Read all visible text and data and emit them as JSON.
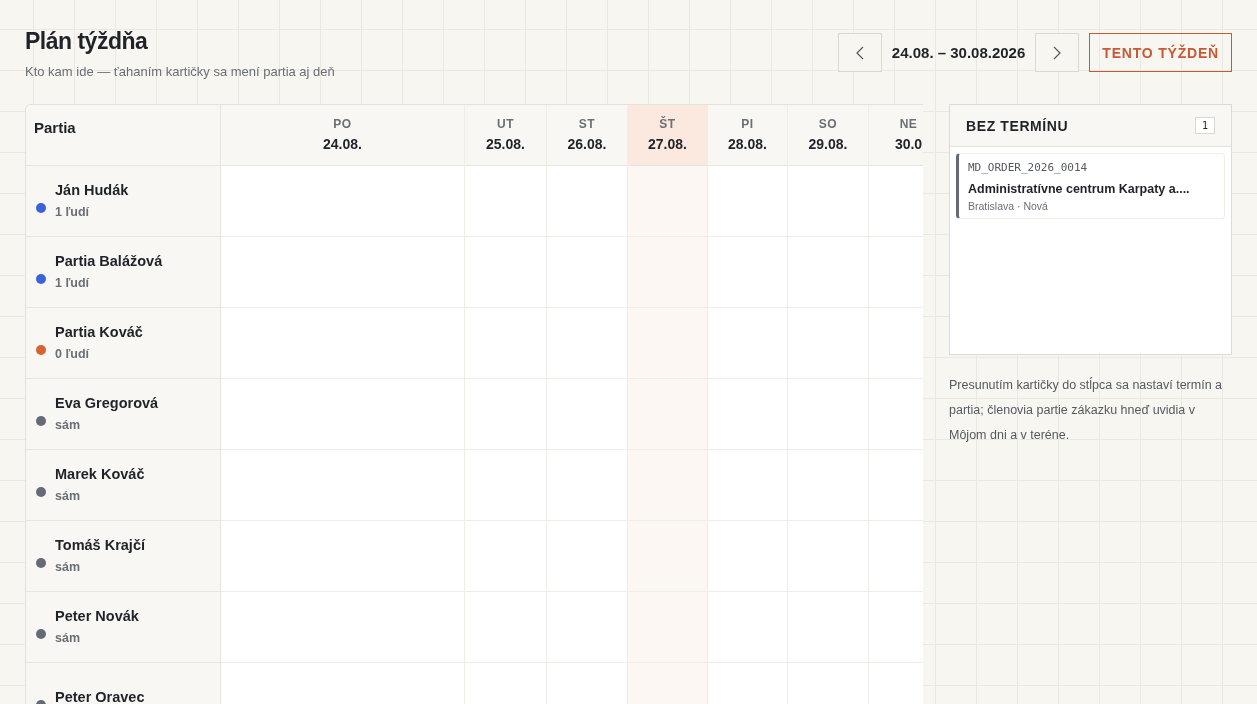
{
  "header": {
    "title": "Plán týždňa",
    "subtitle": "Kto kam ide — ťahaním kartičky sa mení partia aj deň"
  },
  "week_nav": {
    "range": "24.08. – 30.08.2026",
    "today_button": "TENTO TÝŽDEŇ"
  },
  "board": {
    "corner_label": "Partia",
    "days": [
      {
        "name": "PO",
        "date": "24.08.",
        "selected": false
      },
      {
        "name": "UT",
        "date": "25.08.",
        "selected": false
      },
      {
        "name": "ST",
        "date": "26.08.",
        "selected": false
      },
      {
        "name": "ŠT",
        "date": "27.08.",
        "selected": true
      },
      {
        "name": "PI",
        "date": "28.08.",
        "selected": false
      },
      {
        "name": "SO",
        "date": "29.08.",
        "selected": false
      },
      {
        "name": "NE",
        "date": "30.0",
        "selected": false
      }
    ],
    "crews": [
      {
        "name": "Ján Hudák",
        "members": "1 ľudí",
        "color": "#3b63d9"
      },
      {
        "name": "Partia Balážová",
        "members": "1 ľudí",
        "color": "#3b63d9"
      },
      {
        "name": "Partia Kováč",
        "members": "0 ľudí",
        "color": "#d9622f"
      },
      {
        "name": "Eva Gregorová",
        "members": "sám",
        "color": "#646b76"
      },
      {
        "name": "Marek Kováč",
        "members": "sám",
        "color": "#646b76"
      },
      {
        "name": "Tomáš Krajčí",
        "members": "sám",
        "color": "#646b76"
      },
      {
        "name": "Peter Novák",
        "members": "sám",
        "color": "#646b76"
      },
      {
        "name": "Peter Oravec",
        "color": "#646b76"
      }
    ]
  },
  "unscheduled": {
    "title": "BEZ TERMÍNU",
    "count": "1",
    "cards": [
      {
        "code": "MD_ORDER_2026_0014",
        "title": "Administratívne centrum Karpaty a....",
        "meta": "Bratislava · Nová"
      }
    ],
    "note": "Presunutím kartičky do stĺpca sa nastaví termín a partia; členovia partie zákazku hneď uvidia v Môjom dni a v teréne."
  }
}
